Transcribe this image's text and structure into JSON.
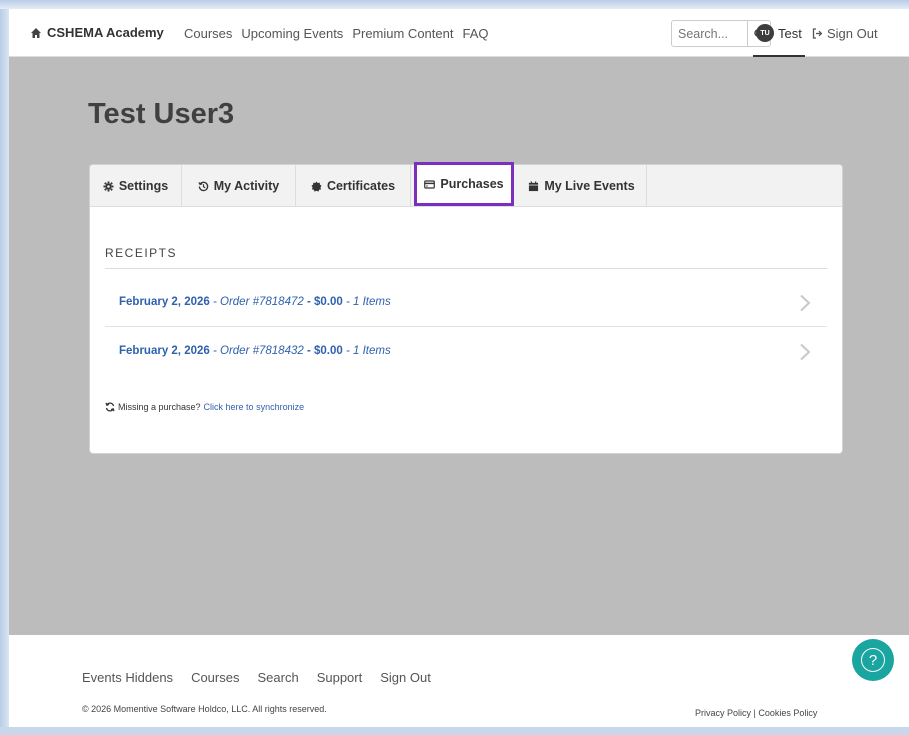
{
  "nav": {
    "brand": "CSHEMA Academy",
    "links": [
      "Courses",
      "Upcoming Events",
      "Premium Content",
      "FAQ"
    ],
    "search_placeholder": "Search...",
    "user_initials": "TU",
    "user_name": "Test",
    "sign_out": "Sign Out"
  },
  "profile": {
    "title": "Test User3",
    "tabs": [
      {
        "label": "Settings",
        "icon": "gear-icon"
      },
      {
        "label": "My Activity",
        "icon": "history-icon"
      },
      {
        "label": "Certificates",
        "icon": "certificate-icon"
      },
      {
        "label": "Purchases",
        "icon": "credit-card-icon",
        "active": true
      },
      {
        "label": "My Live Events",
        "icon": "calendar-icon"
      }
    ]
  },
  "receipts": {
    "heading": "RECEIPTS",
    "items": [
      {
        "date": "February 2, 2026",
        "order": " - Order #7818472",
        "amount": " - $0.00",
        "items": " - 1 Items"
      },
      {
        "date": "February 2, 2026",
        "order": " - Order #7818432",
        "amount": " - $0.00",
        "items": " - 1 Items"
      }
    ],
    "missing_text": "Missing a purchase?",
    "sync_link": "Click here to synchronize"
  },
  "footer": {
    "links": [
      "Events Hiddens",
      "Courses",
      "Search",
      "Support",
      "Sign Out"
    ],
    "copyright": "© 2026 Momentive Software Holdco, LLC. All rights reserved.",
    "policy": "Privacy Policy | Cookies Policy"
  },
  "colors": {
    "link": "#2f61ad",
    "active_tab_border": "#7b2fbe",
    "hero_bg": "#bcbcbd",
    "help_button": "#1aa5a0"
  }
}
